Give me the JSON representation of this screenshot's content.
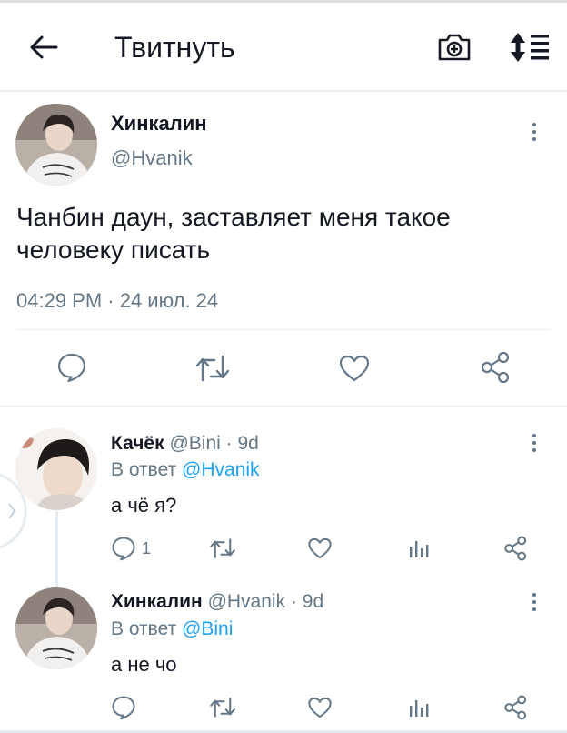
{
  "header": {
    "title": "Твитнуть",
    "back_icon": "arrow-left-icon",
    "camera_icon": "camera-plus-icon",
    "sort_icon": "sort-lines-icon"
  },
  "main_tweet": {
    "name": "Хинкалин",
    "handle": "@Hvanik",
    "text_line1": "Чанбин даун, заставляет меня такое",
    "text_line2": "человеку писать",
    "timestamp": "04:29 PM · 24 июл. 24",
    "actions": [
      "reply-icon",
      "retweet-icon",
      "like-icon",
      "share-icon"
    ]
  },
  "replies": [
    {
      "name": "Качёк",
      "handle": "@Bini",
      "age": "· 9d",
      "reply_prefix": "В ответ",
      "reply_to": "@Hvanik",
      "text": "а чё я?",
      "reply_count": "1"
    },
    {
      "name": "Хинкалин",
      "handle": "@Hvanik",
      "age": "· 9d",
      "reply_prefix": "В ответ",
      "reply_to": "@Bini",
      "text": "а не чо",
      "reply_count": ""
    }
  ],
  "colors": {
    "accent": "#1da1f2",
    "icon": "#657786",
    "divider": "#e6ecf0"
  }
}
